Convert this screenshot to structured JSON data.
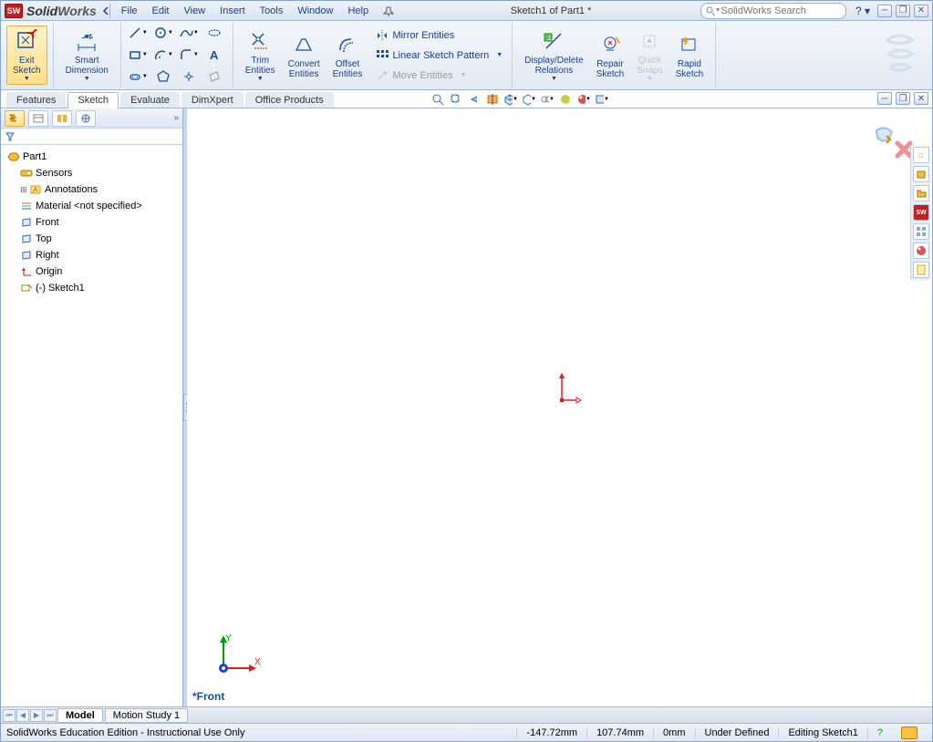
{
  "app": {
    "title_a": "Solid",
    "title_b": "Works",
    "doc_title": "Sketch1 of Part1 *"
  },
  "menu": {
    "file": "File",
    "edit": "Edit",
    "view": "View",
    "insert": "Insert",
    "tools": "Tools",
    "window": "Window",
    "help": "Help"
  },
  "search": {
    "placeholder": "SolidWorks Search"
  },
  "ribbon": {
    "exit_sketch": "Exit\nSketch",
    "smart_dimension": "Smart\nDimension",
    "trim": "Trim\nEntities",
    "convert": "Convert\nEntities",
    "offset": "Offset\nEntities",
    "mirror": "Mirror Entities",
    "linear_pattern": "Linear Sketch Pattern",
    "move": "Move Entities",
    "display_relations": "Display/Delete\nRelations",
    "repair": "Repair\nSketch",
    "quick_snaps": "Quick\nSnaps",
    "rapid": "Rapid\nSketch"
  },
  "tabs": {
    "features": "Features",
    "sketch": "Sketch",
    "evaluate": "Evaluate",
    "dimxpert": "DimXpert",
    "office": "Office Products"
  },
  "tree": {
    "root": "Part1",
    "sensors": "Sensors",
    "annotations": "Annotations",
    "material": "Material <not specified>",
    "front": "Front",
    "top": "Top",
    "right": "Right",
    "origin": "Origin",
    "sketch1": "(-) Sketch1"
  },
  "viewport": {
    "view_label": "*Front"
  },
  "bottom_tabs": {
    "model": "Model",
    "motion": "Motion Study 1"
  },
  "status": {
    "edition": "SolidWorks Education Edition - Instructional Use Only",
    "coord_x": "-147.72mm",
    "coord_y": "107.74mm",
    "coord_z": "0mm",
    "defined": "Under Defined",
    "editing": "Editing Sketch1"
  }
}
